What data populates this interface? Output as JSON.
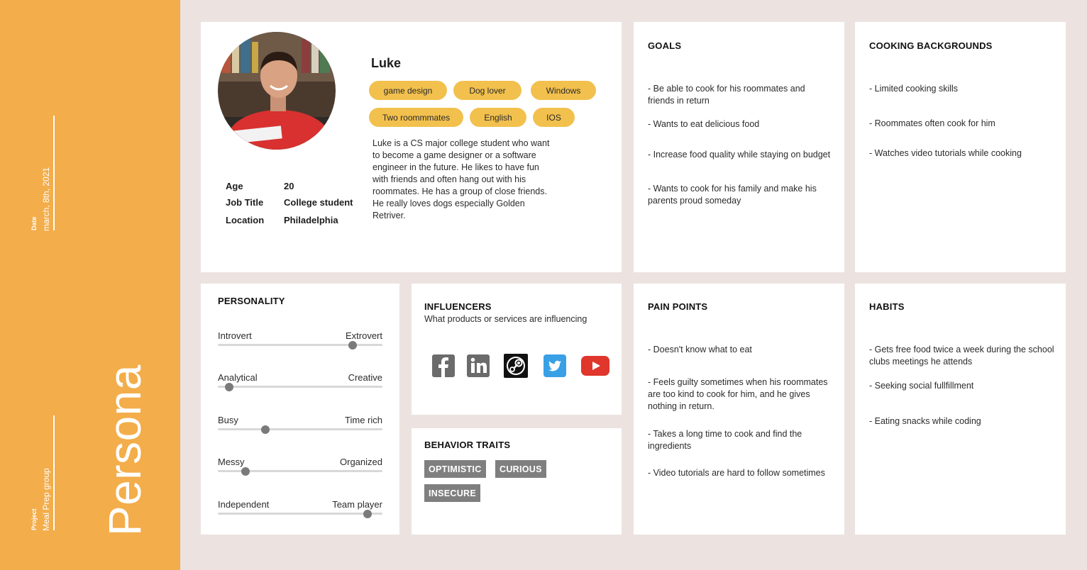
{
  "sidebar": {
    "date_label": "Date",
    "date_value": "march, 8th, 2021",
    "project_label": "Project",
    "project_value": "Meal Prep group",
    "title": "Persona"
  },
  "profile": {
    "name": "Luke",
    "tags": [
      "game design",
      "Dog lover",
      "Windows",
      "Two roommmates",
      "English",
      "IOS"
    ],
    "info": [
      {
        "key": "Age",
        "value": "20"
      },
      {
        "key": "Job Title",
        "value": "College student"
      },
      {
        "key": "Location",
        "value": "Philadelphia"
      }
    ],
    "bio": "Luke is a CS major college student who want to become a game designer or a software engineer in the future. He likes to have fun with friends and often hang out with his roommates. He has a group of close friends. He really loves dogs especially Golden Retriver."
  },
  "goals": {
    "heading": "GOALS",
    "items": [
      "- Be able to cook for his roommates and friends in return",
      "- Wants to eat delicious food",
      "- Increase food quality while staying on budget",
      "- Wants to cook for his family and make his parents proud someday"
    ]
  },
  "cooking": {
    "heading": "COOKING BACKGROUNDS",
    "items": [
      "- Limited cooking skills",
      "- Roommates often cook for him",
      "- Watches video tutorials while cooking"
    ]
  },
  "personality": {
    "heading": "PERSONALITY",
    "sliders": [
      {
        "left": "Introvert",
        "right": "Extrovert",
        "value": 0.82
      },
      {
        "left": "Analytical",
        "right": "Creative",
        "value": 0.07
      },
      {
        "left": "Busy",
        "right": "Time rich",
        "value": 0.29
      },
      {
        "left": "Messy",
        "right": "Organized",
        "value": 0.17
      },
      {
        "left": "Independent",
        "right": "Team player",
        "value": 0.91
      }
    ]
  },
  "influencers": {
    "heading": "INFLUENCERS",
    "subheading": "What products or services are influencing",
    "icons": [
      "facebook-icon",
      "linkedin-icon",
      "steam-icon",
      "twitter-icon",
      "youtube-icon"
    ],
    "colors": {
      "facebook": "#6b6b6b",
      "linkedin": "#6b6b6b",
      "steam": "#111111",
      "twitter": "#3aa0e6",
      "youtube": "#e0362c"
    }
  },
  "behavior": {
    "heading": "BEHAVIOR TRAITS",
    "traits": [
      "OPTIMISTIC",
      "CURIOUS",
      "INSECURE"
    ]
  },
  "pain_points": {
    "heading": "PAIN POINTS",
    "items": [
      "- Doesn't know what to eat",
      "- Feels guilty sometimes when his roommates are too kind to cook for him, and he gives nothing in return.",
      "- Takes a long time to cook and find the ingredients",
      "- Video tutorials are hard to follow sometimes"
    ]
  },
  "habits": {
    "heading": "HABITS",
    "items": [
      "- Gets free food twice a week during the school clubs meetings he attends",
      "- Seeking social fullfillment",
      "- Eating snacks while coding"
    ]
  },
  "colors": {
    "sidebar": "#f3ad4a",
    "tag": "#f2c04d",
    "trait": "#7f7f7f",
    "background": "#ece3e1"
  }
}
